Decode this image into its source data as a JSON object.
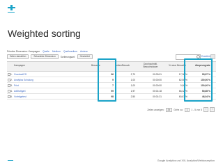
{
  "slide": {
    "title": "Weighted sorting",
    "source": "Google Analytics und XXL Analytics/Webkonzeption"
  },
  "colors": {
    "accent": "#1aa3c8",
    "link": "#3a67c2"
  },
  "toolbar": {
    "primary_dimension_label": "Primäre Dimension: Kampagne",
    "links": [
      "Quelle",
      "Medium",
      "Quellmedium",
      "Andere"
    ],
    "plot_rows_label": "Zeilen darstellen",
    "secondary_dimension": "Sekundäre Dimension",
    "sort_type_label": "Sortierungsart:",
    "sort_type_value": "Gewichtet",
    "advanced_link": "Erweitert"
  },
  "table": {
    "headers": [
      "Kampagne",
      "Besuche",
      "Seiten/Besuch",
      "Durchschnittl. Besuchsdauer",
      "% neue Besuche",
      "Absprungrate"
    ],
    "rows": [
      [
        "1.",
        "GoodwallYD",
        "96",
        "2,70",
        "00:09:01",
        "17,36 %",
        "95,87 %"
      ],
      [
        "2.",
        "Analytics Schulung",
        "9",
        "1,00",
        "00:00:00",
        "62,50 %",
        "100,00 %"
      ],
      [
        "3.",
        "Print",
        "7",
        "1,00",
        "00:00:00",
        "0,00 %",
        "100,00 %"
      ],
      [
        "4.",
        "AdStuttgart",
        "99",
        "1,97",
        "00:01:18",
        "66,32 %",
        "50,85 %"
      ],
      [
        "5.",
        "Vorträgetest",
        "98",
        "2,50",
        "00:01:31",
        "60,67 %",
        "46,04 %"
      ]
    ]
  },
  "pager": {
    "show_rows_label": "Zeilen anzeigen:",
    "rows_value": "25",
    "goto_label": "Gehe zu:",
    "goto_value": "1",
    "range_text": "1 - 5 von 5"
  }
}
